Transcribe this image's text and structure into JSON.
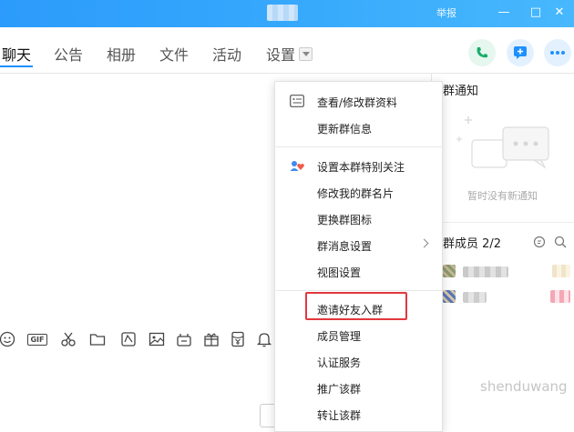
{
  "titlebar": {
    "report_label": "举报",
    "min_label": "—",
    "max_label": "□",
    "close_label": "✕"
  },
  "tabs": [
    {
      "label": "聊天",
      "active": true
    },
    {
      "label": "公告"
    },
    {
      "label": "相册"
    },
    {
      "label": "文件"
    },
    {
      "label": "活动"
    },
    {
      "label": "设置"
    }
  ],
  "header_buttons": [
    "phone-icon",
    "message-plus-icon",
    "more-icon"
  ],
  "colors": {
    "accent": "#1e90ff",
    "titlebar": "#35a7fc",
    "highlight": "#e0393e"
  },
  "side_panel": {
    "notice_title": "群通知",
    "notice_empty": "暂时没有新通知",
    "members_title": "群成员 2/2"
  },
  "toolbar_icons": [
    "emoji-icon",
    "gif-icon",
    "scissors-icon",
    "folder-icon",
    "sticker-icon",
    "image-icon",
    "bag-icon",
    "gift-icon",
    "red-packet-icon",
    "bell-icon"
  ],
  "toolbar_gif_label": "GIF",
  "menu": {
    "items": [
      {
        "label": "查看/修改群资料",
        "icon": "card-icon"
      },
      {
        "label": "更新群信息"
      },
      {
        "label": "设置本群特别关注",
        "icon": "heart-users-icon"
      },
      {
        "label": "修改我的群名片"
      },
      {
        "label": "更换群图标"
      },
      {
        "label": "群消息设置",
        "has_submenu": true
      },
      {
        "label": "视图设置"
      },
      {
        "label": "邀请好友入群",
        "highlighted": true
      },
      {
        "label": "成员管理"
      },
      {
        "label": "认证服务"
      },
      {
        "label": "推广该群"
      },
      {
        "label": "转让该群"
      }
    ]
  },
  "watermark": "shenduwang"
}
